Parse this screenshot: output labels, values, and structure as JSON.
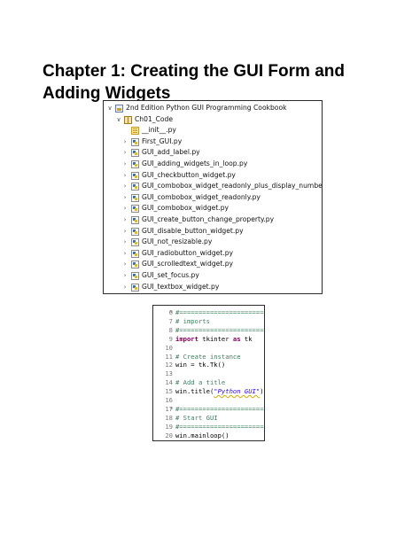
{
  "title": {
    "line1": "Chapter 1: Creating the GUI Form and",
    "line2": "Adding Widgets"
  },
  "explorer": {
    "project": "2nd Edition Python GUI Programming Cookbook",
    "folder": "Ch01_Code",
    "files": [
      {
        "name": "__init__.py",
        "icon": "init-file-icon",
        "expandable": false
      },
      {
        "name": "First_GUI.py",
        "icon": "python-file-icon",
        "expandable": true
      },
      {
        "name": "GUI_add_label.py",
        "icon": "python-file-icon",
        "expandable": true
      },
      {
        "name": "GUI_adding_widgets_in_loop.py",
        "icon": "python-file-icon",
        "expandable": true
      },
      {
        "name": "GUI_checkbutton_widget.py",
        "icon": "python-file-icon",
        "expandable": true
      },
      {
        "name": "GUI_combobox_widget_readonly_plus_display_number.py",
        "icon": "python-file-icon",
        "expandable": true
      },
      {
        "name": "GUI_combobox_widget_readonly.py",
        "icon": "python-file-icon",
        "expandable": true
      },
      {
        "name": "GUI_combobox_widget.py",
        "icon": "python-file-icon",
        "expandable": true
      },
      {
        "name": "GUI_create_button_change_property.py",
        "icon": "python-file-icon",
        "expandable": true
      },
      {
        "name": "GUI_disable_button_widget.py",
        "icon": "python-file-icon",
        "expandable": true
      },
      {
        "name": "GUI_not_resizable.py",
        "icon": "python-file-icon",
        "expandable": true
      },
      {
        "name": "GUI_radiobutton_widget.py",
        "icon": "python-file-icon",
        "expandable": true
      },
      {
        "name": "GUI_scrolledtext_widget.py",
        "icon": "python-file-icon",
        "expandable": true
      },
      {
        "name": "GUI_set_focus.py",
        "icon": "python-file-icon",
        "expandable": true
      },
      {
        "name": "GUI_textbox_widget.py",
        "icon": "python-file-icon",
        "expandable": true
      }
    ]
  },
  "editor": {
    "colors": {
      "comment": "#3f7f5f",
      "keyword": "#7f0055",
      "string": "#2a00ff",
      "line_number": "#7a7a7a"
    },
    "lines": [
      {
        "n": "6",
        "fold": "⊖",
        "tokens": [
          {
            "t": "#======================",
            "c": "comment"
          }
        ]
      },
      {
        "n": "7",
        "fold": "",
        "tokens": [
          {
            "t": "# imports",
            "c": "comment"
          }
        ]
      },
      {
        "n": "8",
        "fold": "",
        "tokens": [
          {
            "t": "#======================",
            "c": "comment"
          }
        ]
      },
      {
        "n": "9",
        "fold": "",
        "tokens": [
          {
            "t": "import",
            "c": "kw"
          },
          {
            "t": " tkinter ",
            "c": "plain"
          },
          {
            "t": "as",
            "c": "kw"
          },
          {
            "t": " tk",
            "c": "plain"
          }
        ]
      },
      {
        "n": "10",
        "fold": "",
        "tokens": []
      },
      {
        "n": "11",
        "fold": "",
        "tokens": [
          {
            "t": "# Create instance",
            "c": "comment"
          }
        ]
      },
      {
        "n": "12",
        "fold": "",
        "tokens": [
          {
            "t": "win = tk.Tk()",
            "c": "plain"
          }
        ]
      },
      {
        "n": "13",
        "fold": "",
        "tokens": []
      },
      {
        "n": "14",
        "fold": "",
        "tokens": [
          {
            "t": "# Add a title",
            "c": "comment"
          }
        ]
      },
      {
        "n": "15",
        "fold": "",
        "tokens": [
          {
            "t": "win.title(",
            "c": "plain"
          },
          {
            "t": "\"Python GUI\"",
            "c": "str"
          },
          {
            "t": ")",
            "c": "plain"
          }
        ]
      },
      {
        "n": "16",
        "fold": "",
        "tokens": []
      },
      {
        "n": "17",
        "fold": "⊖",
        "tokens": [
          {
            "t": "#======================",
            "c": "comment"
          }
        ]
      },
      {
        "n": "18",
        "fold": "",
        "tokens": [
          {
            "t": "# Start GUI",
            "c": "comment"
          }
        ]
      },
      {
        "n": "19",
        "fold": "",
        "tokens": [
          {
            "t": "#======================",
            "c": "comment"
          }
        ]
      },
      {
        "n": "20",
        "fold": "",
        "tokens": [
          {
            "t": "win.mainloop()",
            "c": "plain"
          }
        ]
      }
    ]
  }
}
